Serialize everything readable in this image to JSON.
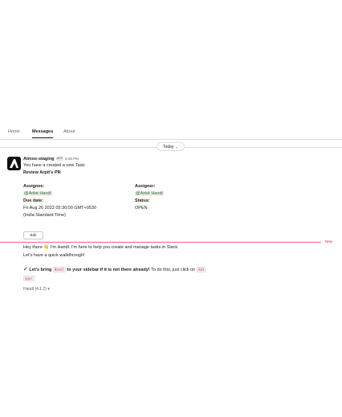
{
  "tabs": [
    "Home",
    "Messages",
    "About"
  ],
  "day_divider": "Today",
  "message": {
    "sender": "Atmos-staging",
    "app_badge": "APP",
    "time": "8:49 PM",
    "line1": "You have a created a new Task:",
    "task_title": "Review Arpit's PR",
    "assignee_label": "Assignee:",
    "assignee_value": "@Ankit Handl",
    "assigner_label": "Assigner:",
    "assigner_value": "@Ankit Handl",
    "due_label": "Due date:",
    "due_value": "Fri Aug 26 2022 05:30:00 GMT+0530",
    "due_value2": "(India Standard Time)",
    "status_label": "Status:",
    "status_value": "OPEN",
    "edit_label": "Edit"
  },
  "new_marker": "New",
  "welcome": {
    "line1_a": "Hey there",
    "line1_b": "I'm Handl. I'm here to help you create and manage tasks in Slack.",
    "line2": "Let's have a quick walkthrough!",
    "line3_a": "Let's bring",
    "code1": "Handl",
    "line3_b": "to your sidebar if it is not there already!",
    "line3_c": "To do this, just click on",
    "code2": "Add",
    "code3": "apps",
    "truncated": "Handl (4.1.2) ▾"
  },
  "icons": {
    "wave": "waving-hand-icon",
    "check": "check-mark-icon",
    "avatar": "atmos-logo"
  }
}
